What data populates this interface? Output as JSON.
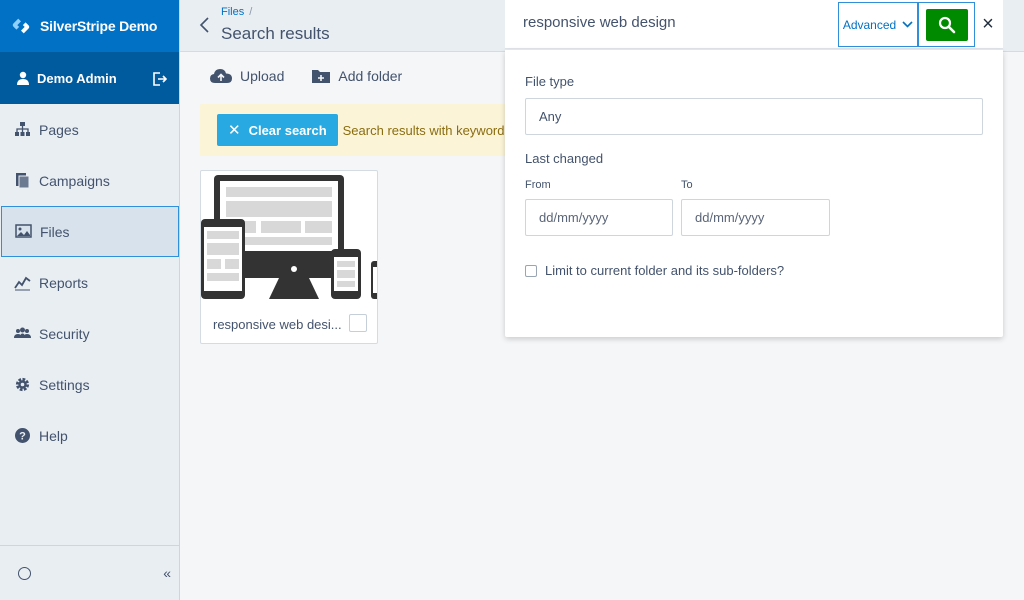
{
  "app": {
    "brand": "SilverStripe Demo"
  },
  "user": {
    "name": "Demo Admin"
  },
  "nav": {
    "items": [
      {
        "label": "Pages",
        "icon": "sitemap-icon"
      },
      {
        "label": "Campaigns",
        "icon": "campaigns-icon"
      },
      {
        "label": "Files",
        "icon": "image-icon",
        "active": true
      },
      {
        "label": "Reports",
        "icon": "chart-line-icon"
      },
      {
        "label": "Security",
        "icon": "users-icon"
      },
      {
        "label": "Settings",
        "icon": "gear-icon"
      },
      {
        "label": "Help",
        "icon": "help-icon"
      }
    ],
    "collapse_label": "«"
  },
  "header": {
    "breadcrumb": "Files",
    "breadcrumb_sep": "/",
    "title": "Search results"
  },
  "toolbar": {
    "upload_label": "Upload",
    "add_folder_label": "Add folder"
  },
  "notice": {
    "clear_label": "Clear search",
    "text": "Search results with keywords"
  },
  "files": [
    {
      "name": "responsive web desi..."
    }
  ],
  "search": {
    "query": "responsive web design",
    "advanced_label": "Advanced",
    "close_label": "×",
    "file_type_label": "File type",
    "file_type_value": "Any",
    "last_changed_label": "Last changed",
    "from_label": "From",
    "to_label": "To",
    "from_placeholder": "dd/mm/yyyy",
    "to_placeholder": "dd/mm/yyyy",
    "limit_label": "Limit to current folder and its sub-folders?"
  },
  "colors": {
    "brand": "#0071c4",
    "brand_dark": "#005a9e",
    "search_green": "#008a00",
    "clear_blue": "#29a9e1",
    "notice_bg": "#fcf4d7"
  }
}
